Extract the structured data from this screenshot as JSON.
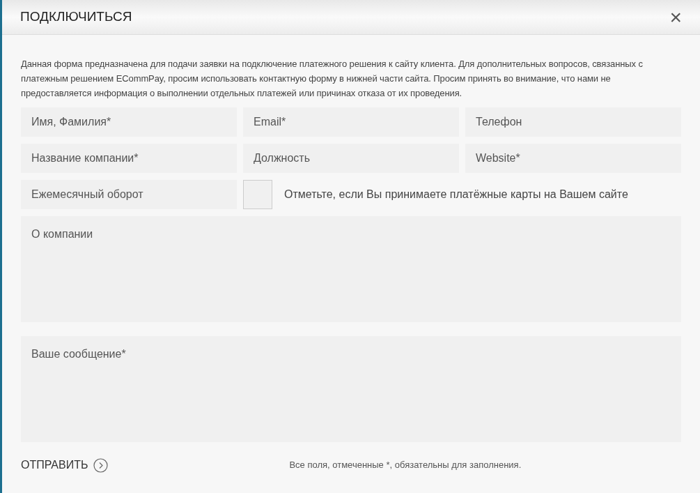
{
  "dialog": {
    "title": "ПОДКЛЮЧИТЬСЯ",
    "close": "×"
  },
  "description": "Данная форма предназначена для подачи заявки на подключение платежного решения к сайту клиента. Для дополнительных вопросов, связанных с платежным решением ECommPay, просим использовать контактную форму в нижней части сайта. Просим принять во внимание, что нами не предоставляется информация о выполнении отдельных платежей или причинах отказа от их проведения.",
  "fields": [
    {
      "placeholder": "Имя, Фамилия*"
    },
    {
      "placeholder": "Email*"
    },
    {
      "placeholder": "Телефон"
    },
    {
      "placeholder": "Название компании*"
    },
    {
      "placeholder": "Должность"
    },
    {
      "placeholder": "Website*"
    },
    {
      "placeholder": "Ежемесячный оборот"
    }
  ],
  "checkbox": {
    "label": "Отметьте, если Вы принимаете платёжные карты на Вашем сайте",
    "checked": false
  },
  "textareas": [
    {
      "placeholder": "О компании"
    },
    {
      "placeholder": "Ваше сообщение*"
    }
  ],
  "submit": "ОТПРАВИТЬ",
  "note": "Все поля, отмеченные *, обязательны для заполнения."
}
